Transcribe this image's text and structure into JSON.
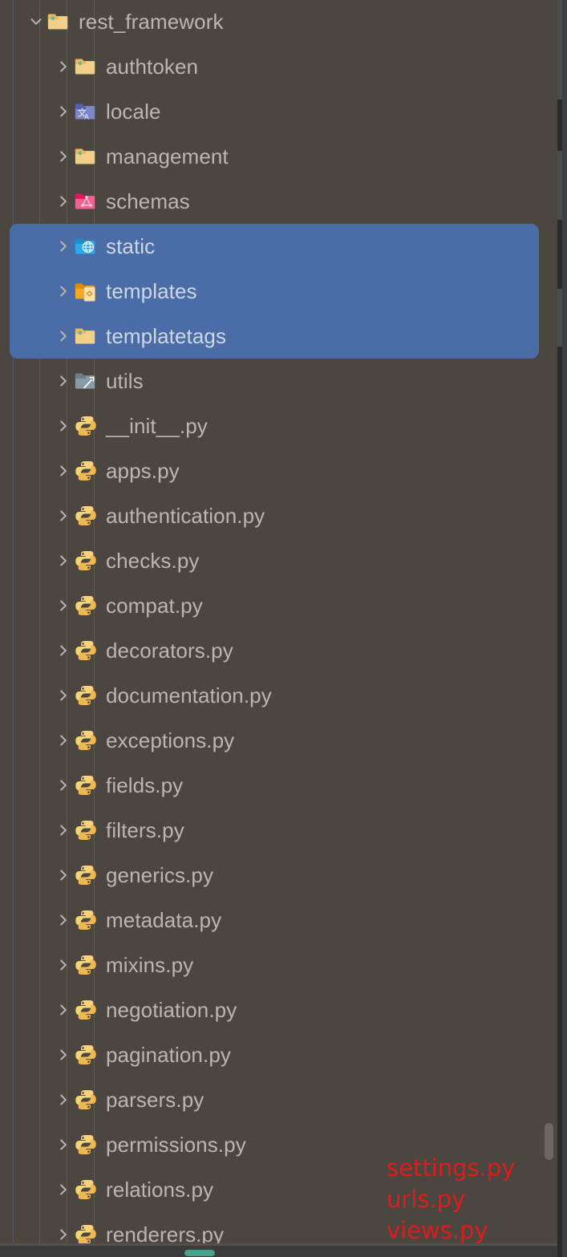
{
  "panel": {
    "name": "project-file-explorer",
    "background_color": "#4b4740",
    "selection_color": "#4a6da7",
    "text_color": "#b9b7b1",
    "indent_guide_color": "#5a5f69"
  },
  "tree": {
    "rows": [
      {
        "label": "rest_framework",
        "icon": "folder-open-amber-icon",
        "expanded": true,
        "depth": 2,
        "selected": false
      },
      {
        "label": "authtoken",
        "icon": "folder-amber-icon",
        "expanded": false,
        "depth": 3,
        "selected": false
      },
      {
        "label": "locale",
        "icon": "folder-locale-icon",
        "expanded": false,
        "depth": 3,
        "selected": false
      },
      {
        "label": "management",
        "icon": "folder-amber-icon",
        "expanded": false,
        "depth": 3,
        "selected": false
      },
      {
        "label": "schemas",
        "icon": "folder-graphql-icon",
        "expanded": false,
        "depth": 3,
        "selected": false
      },
      {
        "label": "static",
        "icon": "folder-globe-icon",
        "expanded": false,
        "depth": 3,
        "selected": true
      },
      {
        "label": "templates",
        "icon": "folder-template-icon",
        "expanded": false,
        "depth": 3,
        "selected": true
      },
      {
        "label": "templatetags",
        "icon": "folder-amber-icon",
        "expanded": false,
        "depth": 3,
        "selected": true
      },
      {
        "label": "utils",
        "icon": "folder-tools-icon",
        "expanded": false,
        "depth": 3,
        "selected": false
      },
      {
        "label": "__init__.py",
        "icon": "python-file-icon",
        "expanded": false,
        "depth": 3,
        "selected": false
      },
      {
        "label": "apps.py",
        "icon": "python-file-icon",
        "expanded": false,
        "depth": 3,
        "selected": false
      },
      {
        "label": "authentication.py",
        "icon": "python-file-icon",
        "expanded": false,
        "depth": 3,
        "selected": false
      },
      {
        "label": "checks.py",
        "icon": "python-file-icon",
        "expanded": false,
        "depth": 3,
        "selected": false
      },
      {
        "label": "compat.py",
        "icon": "python-file-icon",
        "expanded": false,
        "depth": 3,
        "selected": false
      },
      {
        "label": "decorators.py",
        "icon": "python-file-icon",
        "expanded": false,
        "depth": 3,
        "selected": false
      },
      {
        "label": "documentation.py",
        "icon": "python-file-icon",
        "expanded": false,
        "depth": 3,
        "selected": false
      },
      {
        "label": "exceptions.py",
        "icon": "python-file-icon",
        "expanded": false,
        "depth": 3,
        "selected": false
      },
      {
        "label": "fields.py",
        "icon": "python-file-icon",
        "expanded": false,
        "depth": 3,
        "selected": false
      },
      {
        "label": "filters.py",
        "icon": "python-file-icon",
        "expanded": false,
        "depth": 3,
        "selected": false
      },
      {
        "label": "generics.py",
        "icon": "python-file-icon",
        "expanded": false,
        "depth": 3,
        "selected": false
      },
      {
        "label": "metadata.py",
        "icon": "python-file-icon",
        "expanded": false,
        "depth": 3,
        "selected": false
      },
      {
        "label": "mixins.py",
        "icon": "python-file-icon",
        "expanded": false,
        "depth": 3,
        "selected": false
      },
      {
        "label": "negotiation.py",
        "icon": "python-file-icon",
        "expanded": false,
        "depth": 3,
        "selected": false
      },
      {
        "label": "pagination.py",
        "icon": "python-file-icon",
        "expanded": false,
        "depth": 3,
        "selected": false
      },
      {
        "label": "parsers.py",
        "icon": "python-file-icon",
        "expanded": false,
        "depth": 3,
        "selected": false
      },
      {
        "label": "permissions.py",
        "icon": "python-file-icon",
        "expanded": false,
        "depth": 3,
        "selected": false
      },
      {
        "label": "relations.py",
        "icon": "python-file-icon",
        "expanded": false,
        "depth": 3,
        "selected": false
      },
      {
        "label": "renderers.py",
        "icon": "python-file-icon",
        "expanded": false,
        "depth": 3,
        "selected": false
      }
    ]
  },
  "annotations": {
    "color": "#e01b1b",
    "lines": [
      "settings.py",
      "urls.py",
      "views.py"
    ]
  },
  "scrollbars": {
    "vertical_thumb_color": "#6b6862",
    "horizontal_thumb_color": "#4aa089"
  }
}
